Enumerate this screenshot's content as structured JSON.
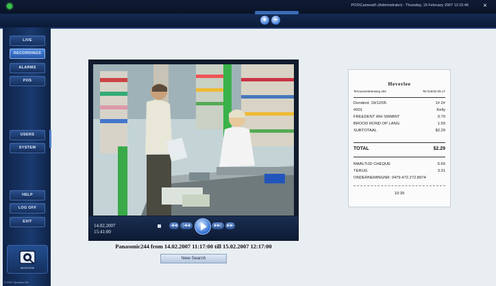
{
  "window": {
    "status_text": "POS\\Camera6\\ (Administrator) - Thursday, 15 February 2007 12:15:46",
    "close_label": "×"
  },
  "zoom": {
    "plus": "+",
    "minus": "−"
  },
  "sidebar": {
    "nav": [
      {
        "label": "LIVE"
      },
      {
        "label": "RECORDINGS"
      },
      {
        "label": "ALARMS"
      },
      {
        "label": "POS"
      },
      {
        "label": "USERS"
      },
      {
        "label": "SYSTEM"
      },
      {
        "label": "HELP"
      },
      {
        "label": "LOG OFF"
      },
      {
        "label": "EXIT"
      }
    ],
    "brand_icon": "camera-logo-icon",
    "brand_text": "MILESTONE",
    "copyright": "© 2007 Quadrox NV"
  },
  "player": {
    "date": "14.02.2007",
    "time": "15:41:00",
    "buttons": {
      "stop": "■",
      "prev": "◀◀",
      "rewind": "|◀◀",
      "play": "▶",
      "ffwd": "▶▶|",
      "next": "▶▶"
    },
    "caption": "Panasonic244 from 14.02.2007 11:17:00 till 15.02.2007 12:17:00",
    "new_search": "New Search"
  },
  "receipt": {
    "store": "Heverlee",
    "address": "Tervuursesteenweg 194",
    "phone": "Tel 016/20.05.17",
    "date_line": "Donderd. 19/12/05",
    "register": "1# 2#",
    "cashier_no": "#001",
    "cashier": "Kelly",
    "items": [
      {
        "name": "FREEDENT WH SWMINT",
        "price": "0.70"
      },
      {
        "name": "BROOD ROND OP LANG",
        "price": "1.50"
      },
      {
        "name": "SUBTOTAAL",
        "price": "$2.29"
      }
    ],
    "total_label": "TOTAL",
    "total": "$2.29",
    "payments": [
      {
        "name": "MAALTIJD CHEQUE",
        "price": "5.60"
      },
      {
        "name": "TERUG",
        "price": "3.31"
      }
    ],
    "vat_line": "ONDERNEMINGNR: 0479.472.272.8974",
    "time": "10:39"
  }
}
